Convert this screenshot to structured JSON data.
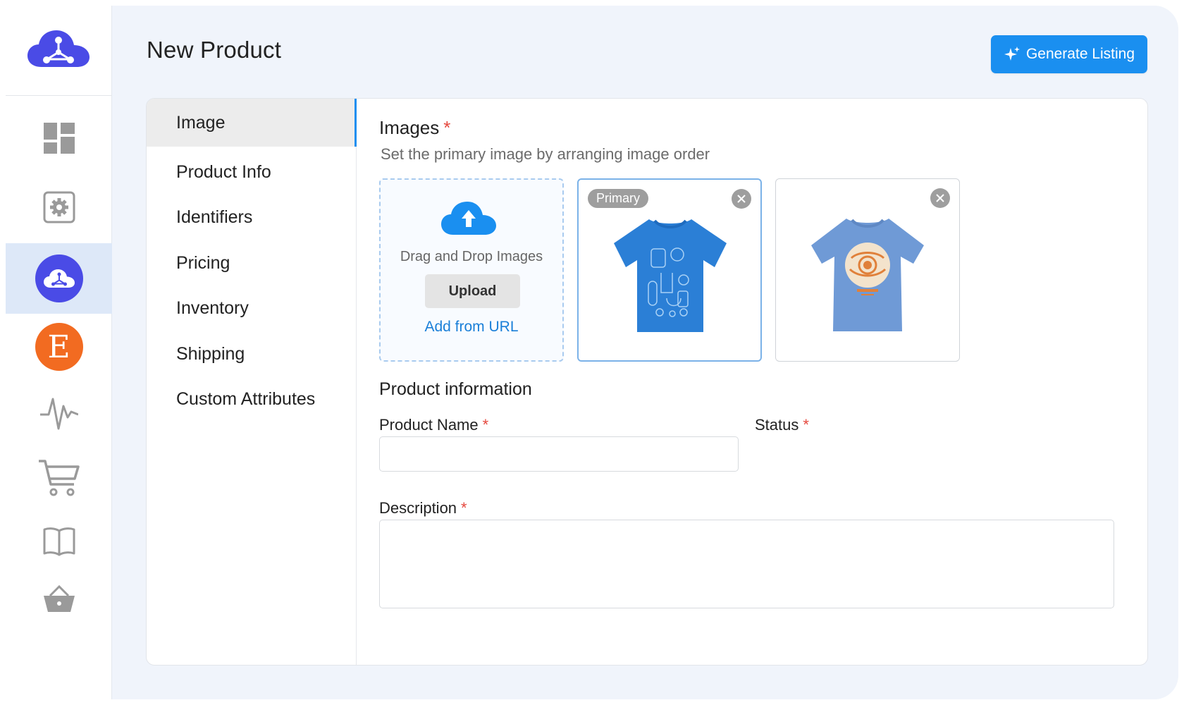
{
  "header": {
    "title": "New Product",
    "generate_label": "Generate Listing"
  },
  "sidebar": {
    "items": [
      {
        "icon": "dashboard-icon"
      },
      {
        "icon": "settings-icon"
      },
      {
        "icon": "cloud-network-icon",
        "active": true
      },
      {
        "icon": "etsy-icon",
        "letter": "E"
      },
      {
        "icon": "activity-icon"
      },
      {
        "icon": "cart-icon"
      },
      {
        "icon": "book-icon"
      },
      {
        "icon": "basket-icon"
      }
    ]
  },
  "tabs": [
    {
      "label": "Image",
      "active": true
    },
    {
      "label": "Product Info"
    },
    {
      "label": "Identifiers"
    },
    {
      "label": "Pricing"
    },
    {
      "label": "Inventory"
    },
    {
      "label": "Shipping"
    },
    {
      "label": "Custom Attributes"
    }
  ],
  "images": {
    "title": "Images",
    "required": "*",
    "hint": "Set the primary image by arranging image order",
    "drop_text": "Drag and Drop Images",
    "upload_label": "Upload",
    "url_label": "Add from URL",
    "primary_badge": "Primary"
  },
  "product_info": {
    "title": "Product information",
    "name_label": "Product Name",
    "status_label": "Status",
    "description_label": "Description",
    "required": "*",
    "name_value": "",
    "description_value": ""
  },
  "colors": {
    "accent": "#1a8ff0",
    "brand": "#4a4be6",
    "etsy": "#f26b21",
    "required": "#e5483e"
  }
}
